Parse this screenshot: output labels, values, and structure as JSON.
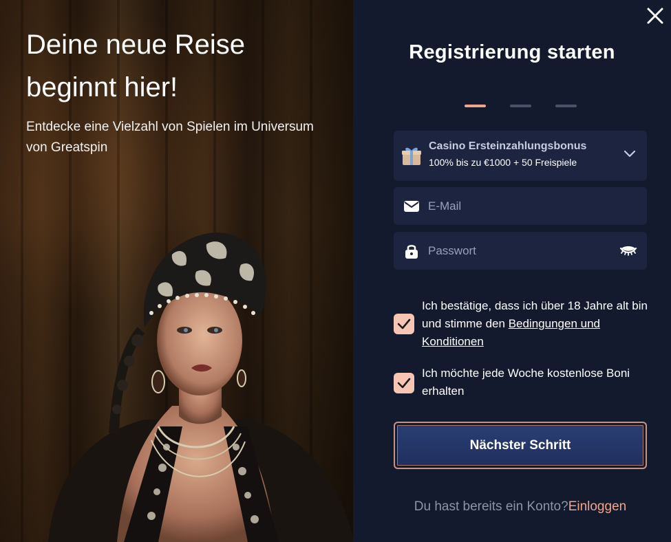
{
  "hero": {
    "title": "Deine neue Reise beginnt hier!",
    "subtitle": "Entdecke eine Vielzahl von Spielen im Universum von Greatspin"
  },
  "form": {
    "title": "Registrierung starten",
    "steps_total": 3,
    "step_current": 1,
    "bonus": {
      "title": "Casino Ersteinzahlungsbonus",
      "description": "100% bis zu €1000 + 50 Freispiele",
      "icon": "gift-icon"
    },
    "email": {
      "placeholder": "E-Mail",
      "value": "",
      "icon": "mail-icon"
    },
    "password": {
      "placeholder": "Passwort",
      "value": "",
      "icon": "lock-icon",
      "toggle_icon": "eye-closed-icon"
    },
    "terms": {
      "checked": true,
      "text_before": "Ich bestätige, dass ich über 18 Jahre alt bin und stimme den ",
      "link": "Bedingungen und Konditionen"
    },
    "newsletter": {
      "checked": true,
      "text": "Ich möchte jede Woche kostenlose Boni erhalten"
    },
    "next_button": "Nächster Schritt",
    "login_prompt": "Du hast bereits ein Konto?",
    "login_link": "Einloggen"
  },
  "colors": {
    "panel_bg": "#141a2e",
    "field_bg": "#1c2440",
    "accent": "#f0a58c",
    "checkbox": "#f6c5b3",
    "button": "#223266"
  }
}
